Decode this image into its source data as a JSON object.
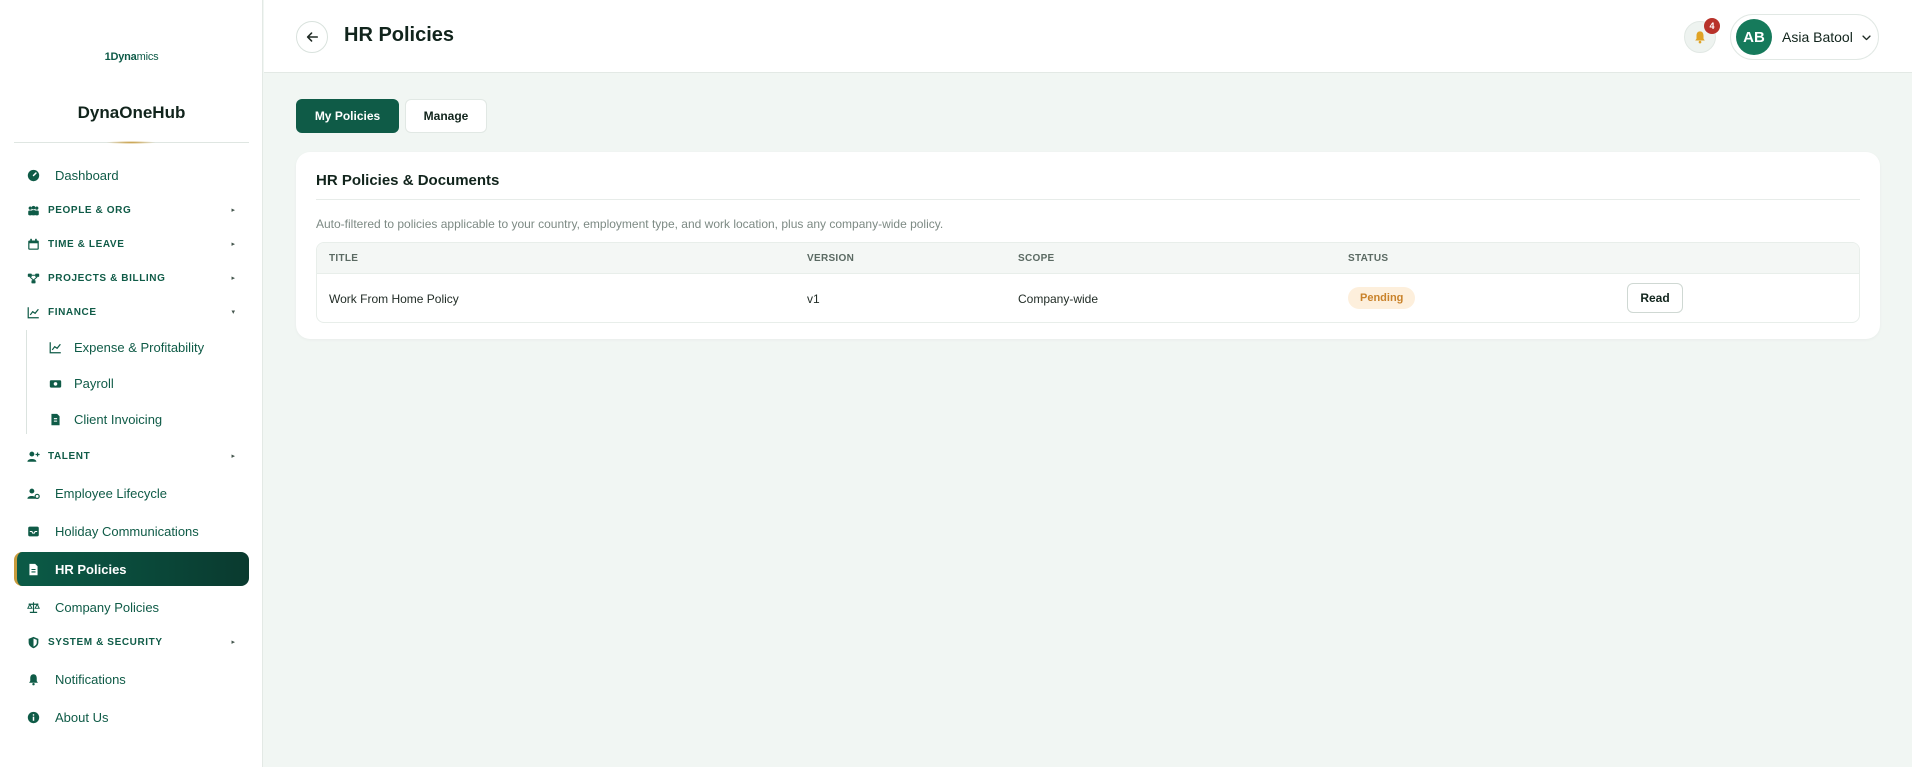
{
  "sidebar": {
    "logo_bold": "1Dyna",
    "logo_thin": "mics",
    "brand": "DynaOneHub",
    "items": [
      {
        "label": "Dashboard",
        "icon": "dashboard-icon"
      },
      {
        "label": "PEOPLE & ORG",
        "icon": "people-icon"
      },
      {
        "label": "TIME & LEAVE",
        "icon": "calendar-icon"
      },
      {
        "label": "PROJECTS & BILLING",
        "icon": "projects-icon"
      },
      {
        "label": "FINANCE",
        "icon": "chart-line-icon"
      },
      {
        "label": "Expense & Profitability",
        "icon": "chart-line-icon"
      },
      {
        "label": "Payroll",
        "icon": "money-icon"
      },
      {
        "label": "Client Invoicing",
        "icon": "invoice-icon"
      },
      {
        "label": "TALENT",
        "icon": "user-plus-icon"
      },
      {
        "label": "Employee Lifecycle",
        "icon": "user-cog-icon"
      },
      {
        "label": "Holiday Communications",
        "icon": "inbox-icon"
      },
      {
        "label": "HR Policies",
        "icon": "document-icon"
      },
      {
        "label": "Company Policies",
        "icon": "scale-icon"
      },
      {
        "label": "SYSTEM & SECURITY",
        "icon": "shield-icon"
      },
      {
        "label": "Notifications",
        "icon": "bell-icon"
      },
      {
        "label": "About Us",
        "icon": "info-icon"
      }
    ]
  },
  "header": {
    "title": "HR Policies",
    "notification_count": "4",
    "user_initials": "AB",
    "user_name": "Asia Batool"
  },
  "tabs": [
    {
      "label": "My Policies",
      "active": true
    },
    {
      "label": "Manage",
      "active": false
    }
  ],
  "card": {
    "title": "HR Policies & Documents",
    "note": "Auto-filtered to policies applicable to your country, employment type, and work location, plus any company-wide policy.",
    "columns": [
      "TITLE",
      "VERSION",
      "SCOPE",
      "STATUS"
    ],
    "rows": [
      {
        "title": "Work From Home Policy",
        "version": "v1",
        "scope": "Company-wide",
        "status": "Pending",
        "action": "Read"
      }
    ]
  },
  "colors": {
    "primary": "#0f5b47",
    "accent": "#c89b3c",
    "pending_bg": "#fdefdc",
    "pending_text": "#c9822a",
    "badge": "#b8322a"
  }
}
